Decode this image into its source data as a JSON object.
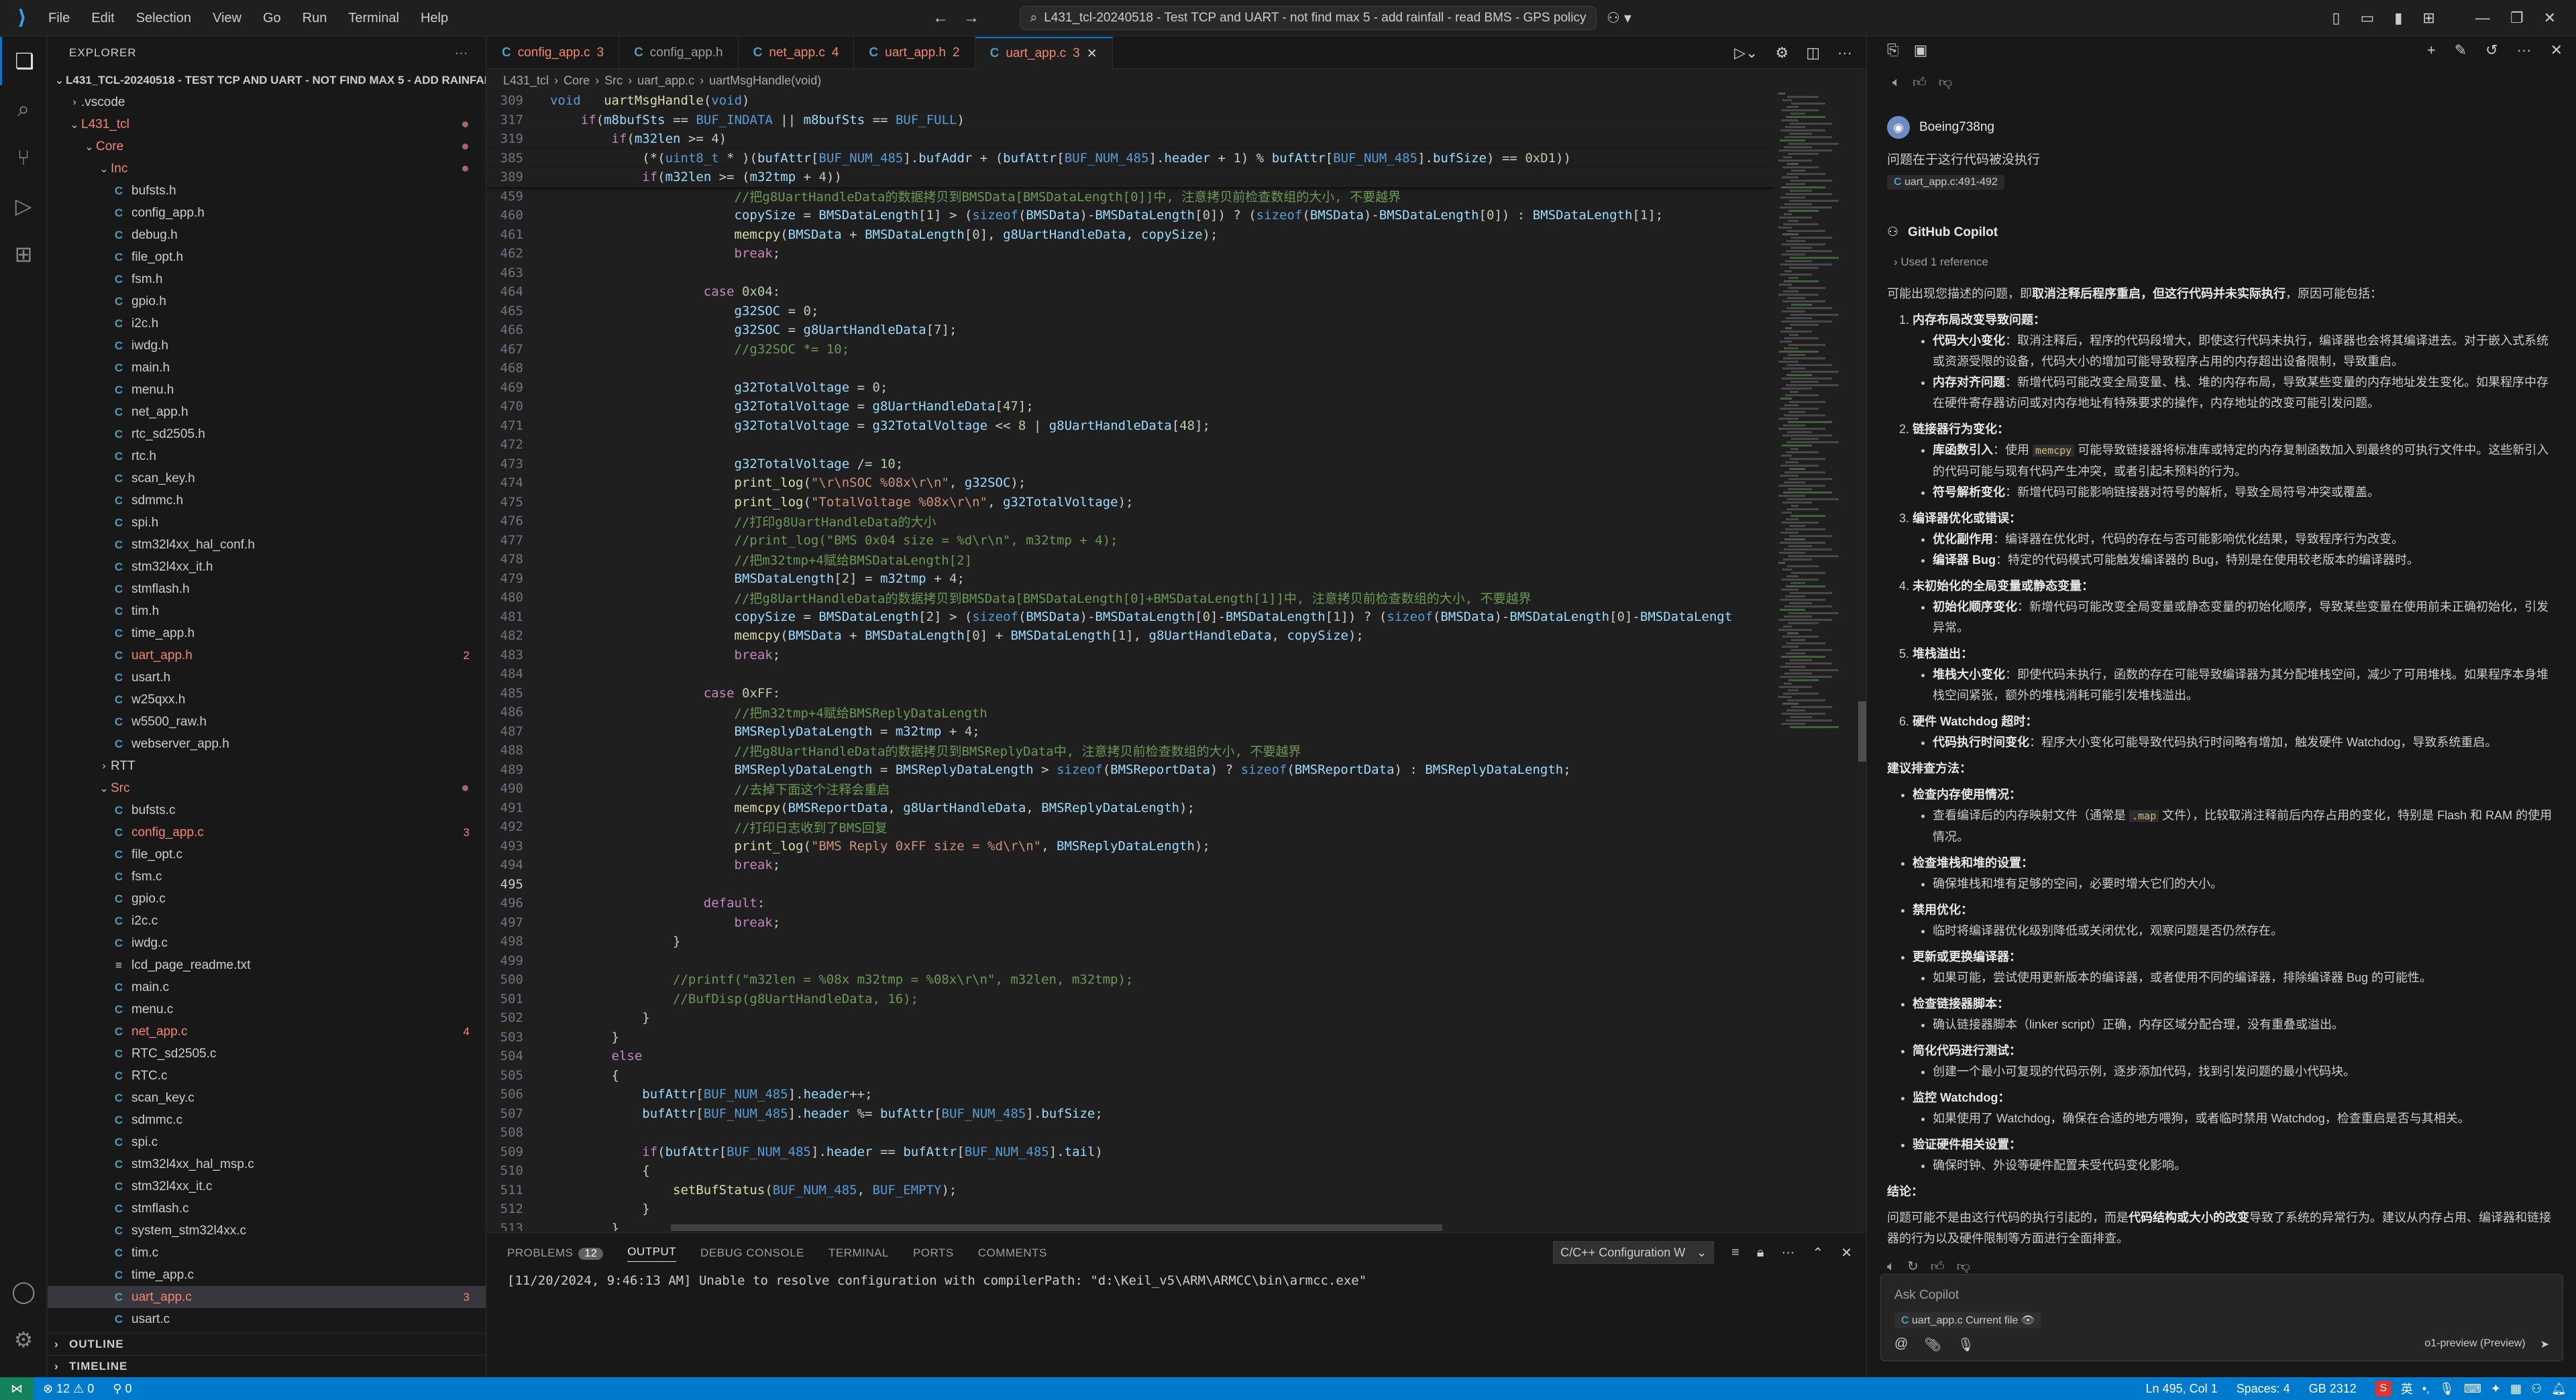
{
  "menu": [
    "File",
    "Edit",
    "Selection",
    "View",
    "Go",
    "Run",
    "Terminal",
    "Help"
  ],
  "window": {
    "search_title": "L431_tcl-20240518 - Test TCP and UART - not find max 5 - add rainfall - read BMS - GPS policy"
  },
  "explorer": {
    "header": "EXPLORER",
    "root": "L431_TCL-20240518 - TEST TCP AND UART - NOT FIND MAX 5 - ADD RAINFALL...",
    "items": [
      {
        "label": ".vscode",
        "indent": 1,
        "type": "folder-closed"
      },
      {
        "label": "L431_tcl",
        "indent": 1,
        "type": "folder-open",
        "err": true,
        "dot": true
      },
      {
        "label": "Core",
        "indent": 2,
        "type": "folder-open",
        "err": true,
        "dot": true
      },
      {
        "label": "Inc",
        "indent": 3,
        "type": "folder-open",
        "err": true,
        "dot": true
      },
      {
        "label": "bufsts.h",
        "indent": 4,
        "type": "c"
      },
      {
        "label": "config_app.h",
        "indent": 4,
        "type": "c"
      },
      {
        "label": "debug.h",
        "indent": 4,
        "type": "c"
      },
      {
        "label": "file_opt.h",
        "indent": 4,
        "type": "c"
      },
      {
        "label": "fsm.h",
        "indent": 4,
        "type": "c"
      },
      {
        "label": "gpio.h",
        "indent": 4,
        "type": "c"
      },
      {
        "label": "i2c.h",
        "indent": 4,
        "type": "c"
      },
      {
        "label": "iwdg.h",
        "indent": 4,
        "type": "c"
      },
      {
        "label": "main.h",
        "indent": 4,
        "type": "c"
      },
      {
        "label": "menu.h",
        "indent": 4,
        "type": "c"
      },
      {
        "label": "net_app.h",
        "indent": 4,
        "type": "c"
      },
      {
        "label": "rtc_sd2505.h",
        "indent": 4,
        "type": "c"
      },
      {
        "label": "rtc.h",
        "indent": 4,
        "type": "c"
      },
      {
        "label": "scan_key.h",
        "indent": 4,
        "type": "c"
      },
      {
        "label": "sdmmc.h",
        "indent": 4,
        "type": "c"
      },
      {
        "label": "spi.h",
        "indent": 4,
        "type": "c"
      },
      {
        "label": "stm32l4xx_hal_conf.h",
        "indent": 4,
        "type": "c"
      },
      {
        "label": "stm32l4xx_it.h",
        "indent": 4,
        "type": "c"
      },
      {
        "label": "stmflash.h",
        "indent": 4,
        "type": "c"
      },
      {
        "label": "tim.h",
        "indent": 4,
        "type": "c"
      },
      {
        "label": "time_app.h",
        "indent": 4,
        "type": "c"
      },
      {
        "label": "uart_app.h",
        "indent": 4,
        "type": "c",
        "err": true,
        "badge": "2"
      },
      {
        "label": "usart.h",
        "indent": 4,
        "type": "c"
      },
      {
        "label": "w25qxx.h",
        "indent": 4,
        "type": "c"
      },
      {
        "label": "w5500_raw.h",
        "indent": 4,
        "type": "c"
      },
      {
        "label": "webserver_app.h",
        "indent": 4,
        "type": "c"
      },
      {
        "label": "RTT",
        "indent": 3,
        "type": "folder-closed"
      },
      {
        "label": "Src",
        "indent": 3,
        "type": "folder-open",
        "err": true,
        "dot": true
      },
      {
        "label": "bufsts.c",
        "indent": 4,
        "type": "c"
      },
      {
        "label": "config_app.c",
        "indent": 4,
        "type": "c",
        "err": true,
        "badge": "3"
      },
      {
        "label": "file_opt.c",
        "indent": 4,
        "type": "c"
      },
      {
        "label": "fsm.c",
        "indent": 4,
        "type": "c"
      },
      {
        "label": "gpio.c",
        "indent": 4,
        "type": "c"
      },
      {
        "label": "i2c.c",
        "indent": 4,
        "type": "c"
      },
      {
        "label": "iwdg.c",
        "indent": 4,
        "type": "c"
      },
      {
        "label": "lcd_page_readme.txt",
        "indent": 4,
        "type": "txt"
      },
      {
        "label": "main.c",
        "indent": 4,
        "type": "c"
      },
      {
        "label": "menu.c",
        "indent": 4,
        "type": "c"
      },
      {
        "label": "net_app.c",
        "indent": 4,
        "type": "c",
        "err": true,
        "badge": "4"
      },
      {
        "label": "RTC_sd2505.c",
        "indent": 4,
        "type": "c"
      },
      {
        "label": "RTC.c",
        "indent": 4,
        "type": "c"
      },
      {
        "label": "scan_key.c",
        "indent": 4,
        "type": "c"
      },
      {
        "label": "sdmmc.c",
        "indent": 4,
        "type": "c"
      },
      {
        "label": "spi.c",
        "indent": 4,
        "type": "c"
      },
      {
        "label": "stm32l4xx_hal_msp.c",
        "indent": 4,
        "type": "c"
      },
      {
        "label": "stm32l4xx_it.c",
        "indent": 4,
        "type": "c"
      },
      {
        "label": "stmflash.c",
        "indent": 4,
        "type": "c"
      },
      {
        "label": "system_stm32l4xx.c",
        "indent": 4,
        "type": "c"
      },
      {
        "label": "tim.c",
        "indent": 4,
        "type": "c"
      },
      {
        "label": "time_app.c",
        "indent": 4,
        "type": "c"
      },
      {
        "label": "uart_app.c",
        "indent": 4,
        "type": "c",
        "err": true,
        "badge": "3",
        "selected": true
      },
      {
        "label": "usart.c",
        "indent": 4,
        "type": "c"
      }
    ],
    "outline": "OUTLINE",
    "timeline": "TIMELINE"
  },
  "tabs": [
    {
      "label": "config_app.c",
      "badge": "3",
      "err": true
    },
    {
      "label": "config_app.h",
      "badge": "",
      "err": false
    },
    {
      "label": "net_app.c",
      "badge": "4",
      "err": true
    },
    {
      "label": "uart_app.h",
      "badge": "2",
      "err": true
    },
    {
      "label": "uart_app.c",
      "badge": "3",
      "err": true,
      "active": true
    }
  ],
  "breadcrumb": [
    "L431_tcl",
    "Core",
    "Src",
    "uart_app.c",
    "uartMsgHandle(void)"
  ],
  "code": {
    "sticky": [
      {
        "n": "309",
        "t": "void   uartMsgHandle(void)"
      },
      {
        "n": "317",
        "t": "    if(m8bufSts == BUF_INDATA || m8bufSts == BUF_FULL)"
      },
      {
        "n": "319",
        "t": "        if(m32len >= 4)"
      },
      {
        "n": "385",
        "t": "            (*(uint8_t * )(bufAttr[BUF_NUM_485].bufAddr + (bufAttr[BUF_NUM_485].header + 1) % bufAttr[BUF_NUM_485].bufSize) == 0xD1))"
      },
      {
        "n": "389",
        "t": "            if(m32len >= (m32tmp + 4))"
      }
    ],
    "lines": [
      {
        "n": "459",
        "t": "                        //把g8UartHandleData的数据拷贝到BMSData[BMSDataLength[0]]中, 注意拷贝前检查数组的大小, 不要越界"
      },
      {
        "n": "460",
        "t": "                        copySize = BMSDataLength[1] > (sizeof(BMSData)-BMSDataLength[0]) ? (sizeof(BMSData)-BMSDataLength[0]) : BMSDataLength[1];"
      },
      {
        "n": "461",
        "t": "                        memcpy(BMSData + BMSDataLength[0], g8UartHandleData, copySize);"
      },
      {
        "n": "462",
        "t": "                        break;"
      },
      {
        "n": "463",
        "t": ""
      },
      {
        "n": "464",
        "t": "                    case 0x04:"
      },
      {
        "n": "465",
        "t": "                        g32SOC = 0;"
      },
      {
        "n": "466",
        "t": "                        g32SOC = g8UartHandleData[7];"
      },
      {
        "n": "467",
        "t": "                        //g32SOC *= 10;"
      },
      {
        "n": "468",
        "t": ""
      },
      {
        "n": "469",
        "t": "                        g32TotalVoltage = 0;"
      },
      {
        "n": "470",
        "t": "                        g32TotalVoltage = g8UartHandleData[47];"
      },
      {
        "n": "471",
        "t": "                        g32TotalVoltage = g32TotalVoltage << 8 | g8UartHandleData[48];"
      },
      {
        "n": "472",
        "t": ""
      },
      {
        "n": "473",
        "t": "                        g32TotalVoltage /= 10;"
      },
      {
        "n": "474",
        "t": "                        print_log(\"\\r\\nSOC %08x\\r\\n\", g32SOC);"
      },
      {
        "n": "475",
        "t": "                        print_log(\"TotalVoltage %08x\\r\\n\", g32TotalVoltage);"
      },
      {
        "n": "476",
        "t": "                        //打印g8UartHandleData的大小"
      },
      {
        "n": "477",
        "t": "                        //print_log(\"BMS 0x04 size = %d\\r\\n\", m32tmp + 4);"
      },
      {
        "n": "478",
        "t": "                        //把m32tmp+4赋给BMSDataLength[2]"
      },
      {
        "n": "479",
        "t": "                        BMSDataLength[2] = m32tmp + 4;"
      },
      {
        "n": "480",
        "t": "                        //把g8UartHandleData的数据拷贝到BMSData[BMSDataLength[0]+BMSDataLength[1]]中, 注意拷贝前检查数组的大小, 不要越界"
      },
      {
        "n": "481",
        "t": "                        copySize = BMSDataLength[2] > (sizeof(BMSData)-BMSDataLength[0]-BMSDataLength[1]) ? (sizeof(BMSData)-BMSDataLength[0]-BMSDataLengt"
      },
      {
        "n": "482",
        "t": "                        memcpy(BMSData + BMSDataLength[0] + BMSDataLength[1], g8UartHandleData, copySize);"
      },
      {
        "n": "483",
        "t": "                        break;"
      },
      {
        "n": "484",
        "t": ""
      },
      {
        "n": "485",
        "t": "                    case 0xFF:"
      },
      {
        "n": "486",
        "t": "                        //把m32tmp+4赋给BMSReplyDataLength"
      },
      {
        "n": "487",
        "t": "                        BMSReplyDataLength = m32tmp + 4;"
      },
      {
        "n": "488",
        "t": "                        //把g8UartHandleData的数据拷贝到BMSReplyData中, 注意拷贝前检查数组的大小, 不要越界"
      },
      {
        "n": "489",
        "t": "                        BMSReplyDataLength = BMSReplyDataLength > sizeof(BMSReportData) ? sizeof(BMSReportData) : BMSReplyDataLength;"
      },
      {
        "n": "490",
        "t": "                        //去掉下面这个注释会重启"
      },
      {
        "n": "491",
        "t": "                        memcpy(BMSReportData, g8UartHandleData, BMSReplyDataLength);"
      },
      {
        "n": "492",
        "t": "                        //打印日志收到了BMS回复"
      },
      {
        "n": "493",
        "t": "                        print_log(\"BMS Reply 0xFF size = %d\\r\\n\", BMSReplyDataLength);"
      },
      {
        "n": "494",
        "t": "                        break;"
      },
      {
        "n": "495",
        "t": ""
      },
      {
        "n": "496",
        "t": "                    default:"
      },
      {
        "n": "497",
        "t": "                        break;"
      },
      {
        "n": "498",
        "t": "                }"
      },
      {
        "n": "499",
        "t": ""
      },
      {
        "n": "500",
        "t": "                //printf(\"m32len = %08x m32tmp = %08x\\r\\n\", m32len, m32tmp);"
      },
      {
        "n": "501",
        "t": "                //BufDisp(g8UartHandleData, 16);"
      },
      {
        "n": "502",
        "t": "            }"
      },
      {
        "n": "503",
        "t": "        }"
      },
      {
        "n": "504",
        "t": "        else"
      },
      {
        "n": "505",
        "t": "        {"
      },
      {
        "n": "506",
        "t": "            bufAttr[BUF_NUM_485].header++;"
      },
      {
        "n": "507",
        "t": "            bufAttr[BUF_NUM_485].header %= bufAttr[BUF_NUM_485].bufSize;"
      },
      {
        "n": "508",
        "t": ""
      },
      {
        "n": "509",
        "t": "            if(bufAttr[BUF_NUM_485].header == bufAttr[BUF_NUM_485].tail)"
      },
      {
        "n": "510",
        "t": "            {"
      },
      {
        "n": "511",
        "t": "                setBufStatus(BUF_NUM_485, BUF_EMPTY);"
      },
      {
        "n": "512",
        "t": "            }"
      },
      {
        "n": "513",
        "t": "        }"
      }
    ]
  },
  "panel": {
    "tabs": [
      {
        "label": "PROBLEMS",
        "badge": "12"
      },
      {
        "label": "OUTPUT",
        "badge": "",
        "active": true
      },
      {
        "label": "DEBUG CONSOLE",
        "badge": ""
      },
      {
        "label": "TERMINAL",
        "badge": ""
      },
      {
        "label": "PORTS",
        "badge": ""
      },
      {
        "label": "COMMENTS",
        "badge": ""
      }
    ],
    "select": "C/C++ Configuration W",
    "output": "[11/20/2024, 9:46:13 AM] Unable to resolve configuration with compilerPath: \"d:\\Keil_v5\\ARM\\ARMCC\\bin\\armcc.exe\""
  },
  "chat": {
    "user": "Boeing738ng",
    "user_message": "问题在于这行代码被没执行",
    "user_ref": "uart_app.c:491-492",
    "assistant": "GitHub Copilot",
    "used_ref": "Used 1 reference",
    "intro_a": "可能出现您描述的问题，即",
    "intro_b": "取消注释后程序重启，但这行代码并未实际执行",
    "intro_c": "，原因可能包括：",
    "causes": [
      {
        "title": "内存布局改变导致问题：",
        "subs": [
          {
            "k": "代码大小变化",
            "v": "：取消注释后，程序的代码段增大，即使这行代码未执行，编译器也会将其编译进去。对于嵌入式系统或资源受限的设备，代码大小的增加可能导致程序占用的内存超出设备限制，导致重启。"
          },
          {
            "k": "内存对齐问题",
            "v": "：新增代码可能改变全局变量、栈、堆的内存布局，导致某些变量的内存地址发生变化。如果程序中存在硬件寄存器访问或对内存地址有特殊要求的操作，内存地址的改变可能引发问题。"
          }
        ]
      },
      {
        "title": "链接器行为变化：",
        "subs": [
          {
            "k": "库函数引入",
            "v": "：使用 memcpy 可能导致链接器将标准库或特定的内存复制函数加入到最终的可执行文件中。这些新引入的代码可能与现有代码产生冲突，或者引起未预料的行为。"
          },
          {
            "k": "符号解析变化",
            "v": "：新增代码可能影响链接器对符号的解析，导致全局符号冲突或覆盖。"
          }
        ]
      },
      {
        "title": "编译器优化或错误：",
        "subs": [
          {
            "k": "优化副作用",
            "v": "：编译器在优化时，代码的存在与否可能影响优化结果，导致程序行为改变。"
          },
          {
            "k": "编译器 Bug",
            "v": "：特定的代码模式可能触发编译器的 Bug，特别是在使用较老版本的编译器时。"
          }
        ]
      },
      {
        "title": "未初始化的全局变量或静态变量：",
        "subs": [
          {
            "k": "初始化顺序变化",
            "v": "：新增代码可能改变全局变量或静态变量的初始化顺序，导致某些变量在使用前未正确初始化，引发异常。"
          }
        ]
      },
      {
        "title": "堆栈溢出：",
        "subs": [
          {
            "k": "堆栈大小变化",
            "v": "：即使代码未执行，函数的存在可能导致编译器为其分配堆栈空间，减少了可用堆栈。如果程序本身堆栈空间紧张，额外的堆栈消耗可能引发堆栈溢出。"
          }
        ]
      },
      {
        "title": "硬件 Watchdog 超时：",
        "subs": [
          {
            "k": "代码执行时间变化",
            "v": "：程序大小变化可能导致代码执行时间略有增加，触发硬件 Watchdog，导致系统重启。"
          }
        ]
      }
    ],
    "methods_title": "建议排查方法：",
    "methods": [
      {
        "k": "检查内存使用情况：",
        "v": "查看编译后的内存映射文件（通常是 .map 文件），比较取消注释前后内存占用的变化，特别是 Flash 和 RAM 的使用情况。"
      },
      {
        "k": "检查堆栈和堆的设置：",
        "v": "确保堆栈和堆有足够的空间，必要时增大它们的大小。"
      },
      {
        "k": "禁用优化：",
        "v": "临时将编译器优化级别降低或关闭优化，观察问题是否仍然存在。"
      },
      {
        "k": "更新或更换编译器：",
        "v": "如果可能，尝试使用更新版本的编译器，或者使用不同的编译器，排除编译器 Bug 的可能性。"
      },
      {
        "k": "检查链接器脚本：",
        "v": "确认链接器脚本（linker script）正确，内存区域分配合理，没有重叠或溢出。"
      },
      {
        "k": "简化代码进行测试：",
        "v": "创建一个最小可复现的代码示例，逐步添加代码，找到引发问题的最小代码块。"
      },
      {
        "k": "监控 Watchdog：",
        "v": "如果使用了 Watchdog，确保在合适的地方喂狗，或者临时禁用 Watchdog，检查重启是否与其相关。"
      },
      {
        "k": "验证硬件相关设置：",
        "v": "确保时钟、外设等硬件配置未受代码变化影响。"
      }
    ],
    "conclusion_title": "结论：",
    "conclusion_a": "问题可能不是由这行代码的执行引起的，而是",
    "conclusion_b": "代码结构或大小的改变",
    "conclusion_c": "导致了系统的异常行为。建议从内存占用、编译器和链接器的行为以及硬件限制等方面进行全面排查。",
    "input_placeholder": "Ask Copilot",
    "input_context": "uart_app.c  Current file",
    "model": "o1-preview (Preview)"
  },
  "status": {
    "errors": "12",
    "warnings": "0",
    "ports": "0",
    "position": "Ln 495, Col 1",
    "spaces": "Spaces: 4",
    "encoding": "GB 2312",
    "lang_ime": "英"
  },
  "colors": {
    "accent": "#007acc",
    "error": "#f48771",
    "c_icon": "#519aba"
  }
}
